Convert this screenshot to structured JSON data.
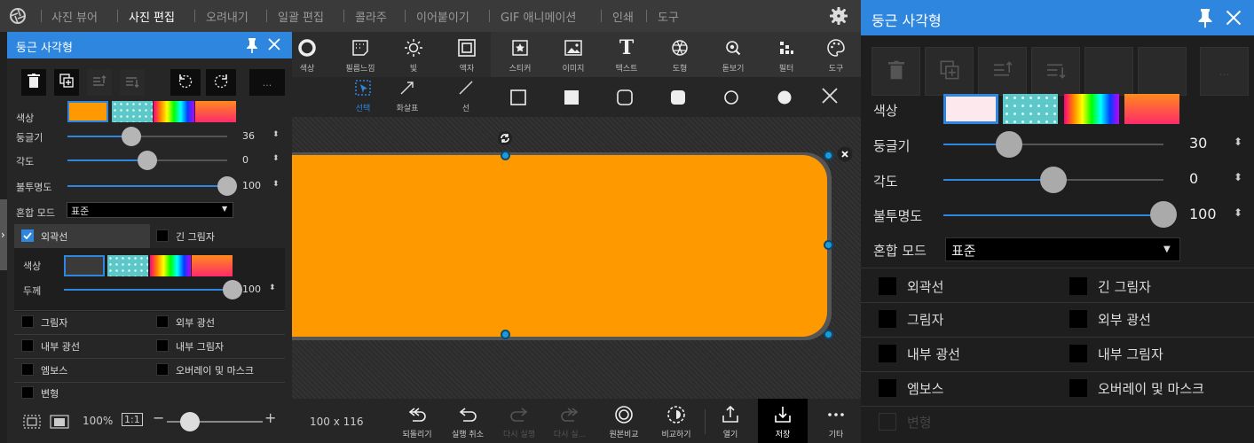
{
  "app": {
    "settings_icon": "gear-icon",
    "logo_icon": "aperture-icon",
    "nav": [
      "사진 뷰어",
      "사진 편집",
      "오려내기",
      "일괄 편집",
      "콜라주",
      "이어붙이기",
      "GIF 애니메이션",
      "인쇄",
      "도구"
    ],
    "nav_active": "사진 편집"
  },
  "left_panel": {
    "title": "둥근 사각형",
    "toolbar_icons": [
      "trash-icon",
      "duplicate-icon",
      "bring-forward-icon",
      "send-backward-icon",
      "rotate-left-icon",
      "rotate-right-icon",
      "more-icon"
    ],
    "more_label": "...",
    "color_label": "색상",
    "roundness": {
      "label": "둥글기",
      "value": "36",
      "fraction": 0.4
    },
    "angle": {
      "label": "각도",
      "value": "0",
      "fraction": 0.5
    },
    "opacity": {
      "label": "불투명도",
      "value": "100",
      "fraction": 1.0
    },
    "blend": {
      "label": "혼합 모드",
      "value": "표준"
    },
    "outline": {
      "label": "외곽선",
      "checked": true
    },
    "long_shadow": {
      "label": "긴 그림자",
      "checked": false
    },
    "outline_color_label": "색상",
    "outline_width": {
      "label": "두께",
      "value": "100",
      "fraction": 1.0
    },
    "effects": [
      {
        "left": "그림자",
        "right": "외부 광선"
      },
      {
        "left": "내부 광선",
        "right": "내부 그림자"
      },
      {
        "left": "엠보스",
        "right": "오버레이 및 마스크"
      }
    ],
    "transform": "변형"
  },
  "tools": [
    {
      "label": "색상",
      "icon": "circle-icon"
    },
    {
      "label": "필름느낌",
      "icon": "film-icon"
    },
    {
      "label": "빛",
      "icon": "sun-icon"
    },
    {
      "label": "액자",
      "icon": "frame-icon"
    },
    {
      "label": "스티커",
      "icon": "sticker-icon"
    },
    {
      "label": "이미지",
      "icon": "image-icon"
    },
    {
      "label": "텍스트",
      "icon": "text-icon"
    },
    {
      "label": "도형",
      "icon": "shape-icon"
    },
    {
      "label": "돋보기",
      "icon": "magnifier-icon"
    },
    {
      "label": "필터",
      "icon": "filter-icon"
    },
    {
      "label": "도구",
      "icon": "palette-icon"
    }
  ],
  "subtools": {
    "select": "선택",
    "arrow": "화살표",
    "line": "선",
    "shape_icons": [
      "rect-outline-icon",
      "rect-filled-icon",
      "rounded-rect-outline-icon",
      "rounded-rect-filled-icon",
      "circle-outline-icon",
      "circle-filled-icon"
    ],
    "close_icon": "close-icon"
  },
  "canvas": {
    "shape_color": "#ff9900",
    "rotate_icon": "rotate-handle-icon",
    "delete_icon": "delete-handle-icon"
  },
  "status": {
    "zoom": "100%",
    "fit_label": "1:1",
    "dimensions": "100 x 116",
    "minus": "−",
    "plus": "+"
  },
  "bottom": [
    {
      "label": "되돌리기",
      "icon": "revert-icon",
      "enabled": true
    },
    {
      "label": "실행 취소",
      "icon": "undo-icon",
      "enabled": true
    },
    {
      "label": "다시 실행",
      "icon": "redo-icon",
      "enabled": false
    },
    {
      "label": "다시 실...",
      "icon": "redo-all-icon",
      "enabled": false
    },
    {
      "label": "원본비교",
      "icon": "compare-original-icon",
      "enabled": true
    },
    {
      "label": "비교하기",
      "icon": "compare-icon",
      "enabled": true
    },
    {
      "label": "열기",
      "icon": "open-icon",
      "enabled": true
    },
    {
      "label": "저장",
      "icon": "save-icon",
      "enabled": true
    },
    {
      "label": "기타",
      "icon": "more-icon",
      "enabled": true
    }
  ],
  "right_panel": {
    "title": "둥근 사각형",
    "more_label": "...",
    "color_label": "색상",
    "roundness": {
      "label": "둥글기",
      "value": "30",
      "fraction": 0.3
    },
    "angle": {
      "label": "각도",
      "value": "0",
      "fraction": 0.5
    },
    "opacity": {
      "label": "불투명도",
      "value": "100",
      "fraction": 1.0
    },
    "blend": {
      "label": "혼합 모드",
      "value": "표준"
    },
    "options": [
      {
        "left": "외곽선",
        "right": "긴 그림자"
      },
      {
        "left": "그림자",
        "right": "외부 광선"
      },
      {
        "left": "내부 광선",
        "right": "내부 그림자"
      },
      {
        "left": "엠보스",
        "right": "오버레이 및 마스크"
      }
    ],
    "transform": "변형"
  },
  "colors": {
    "accent": "#2e86de",
    "shape": "#ff9900",
    "handle": "#1e9bd7"
  }
}
